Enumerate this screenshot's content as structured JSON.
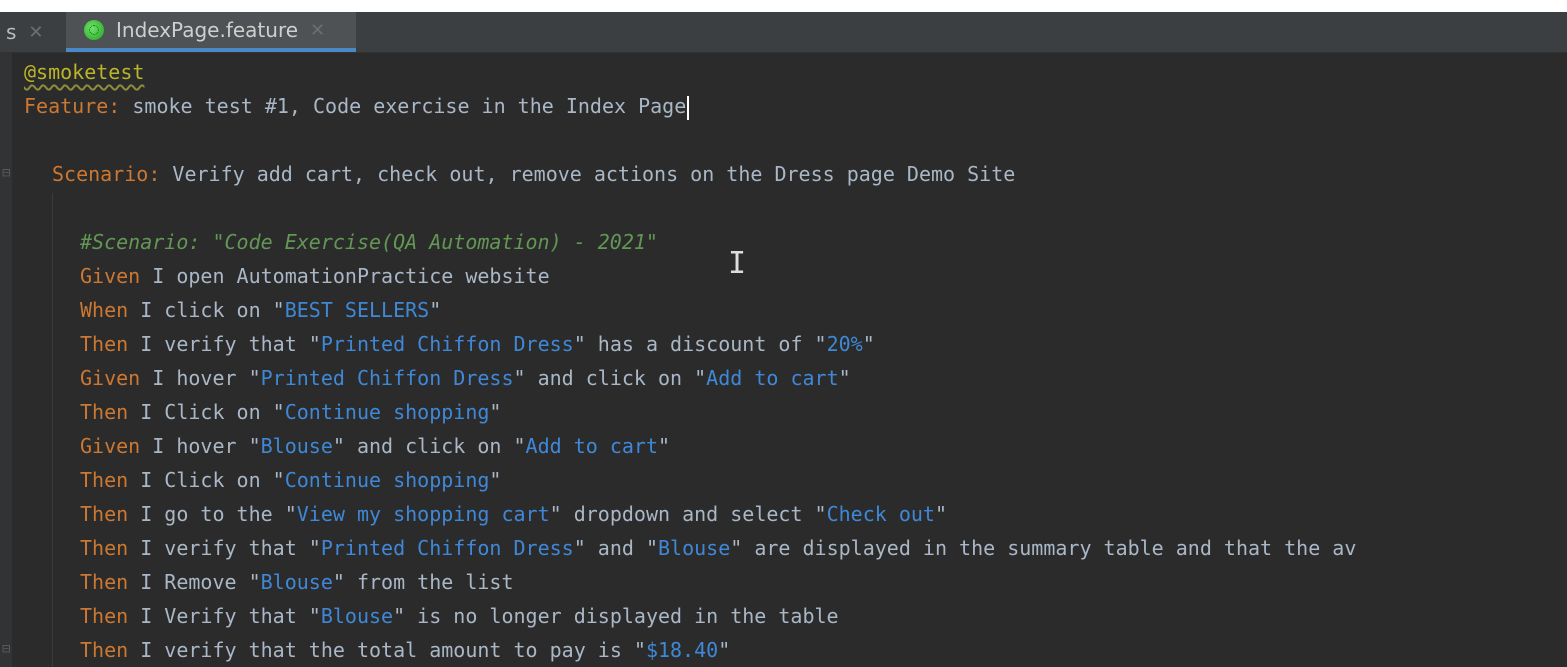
{
  "tabs": {
    "previous_label": "s",
    "active_label": "IndexPage.feature",
    "close_glyph": "✕"
  },
  "icons": {
    "file_icon": "cucumber-icon",
    "fold_icon": "fold-arrow-icon",
    "cursor_icon": "text-cursor-icon"
  },
  "colors": {
    "background": "#2b2b2b",
    "keyword": "#cc7832",
    "string": "#3f88d8",
    "comment": "#629755",
    "tag": "#bbb529",
    "text": "#a9b7c6"
  },
  "editor": {
    "lines": [
      {
        "tag": "@smoketest"
      },
      {
        "kw": "Feature:",
        "text": " smoke test #1, Code exercise in the Index Page"
      },
      {
        "text": ""
      },
      {
        "kw": "Scenario:",
        "text": " Verify add cart, check out, remove actions on the Dress page Demo Site"
      },
      {
        "text": ""
      },
      {
        "comment": "#Scenario: \"Code Exercise(QA Automation) - 2021\""
      },
      {
        "kw": "Given",
        "t1": " I open AutomationPractice website"
      },
      {
        "kw": "When",
        "t1": " I click on \"",
        "s1": "BEST SELLERS",
        "t2": "\""
      },
      {
        "kw": "Then",
        "t1": " I verify that \"",
        "s1": "Printed Chiffon Dress",
        "t2": "\" has a discount of \"",
        "s2": "20%",
        "t3": "\""
      },
      {
        "kw": "Given",
        "t1": " I hover \"",
        "s1": "Printed Chiffon Dress",
        "t2": "\" and click on \"",
        "s2": "Add to cart",
        "t3": "\""
      },
      {
        "kw": "Then",
        "t1": " I Click on \"",
        "s1": "Continue shopping",
        "t2": "\""
      },
      {
        "kw": "Given",
        "t1": " I hover \"",
        "s1": "Blouse",
        "t2": "\" and click on \"",
        "s2": "Add to cart",
        "t3": "\""
      },
      {
        "kw": "Then",
        "t1": " I Click on \"",
        "s1": "Continue shopping",
        "t2": "\""
      },
      {
        "kw": "Then",
        "t1": " I go to the \"",
        "s1": "View my shopping cart",
        "t2": "\" dropdown and select \"",
        "s2": "Check out",
        "t3": "\""
      },
      {
        "kw": "Then",
        "t1": " I verify that \"",
        "s1": "Printed Chiffon Dress",
        "t2": "\" and \"",
        "s2": "Blouse",
        "t3": "\" are displayed in the summary table and that the av"
      },
      {
        "kw": "Then",
        "t1": " I Remove \"",
        "s1": "Blouse",
        "t2": "\" from the list"
      },
      {
        "kw": "Then",
        "t1": " I Verify that \"",
        "s1": "Blouse",
        "t2": "\" is no longer displayed in the table"
      },
      {
        "kw": "Then",
        "t1": " I verify that the total amount to pay is \"",
        "s1": "$18.40",
        "t2": "\""
      }
    ]
  }
}
